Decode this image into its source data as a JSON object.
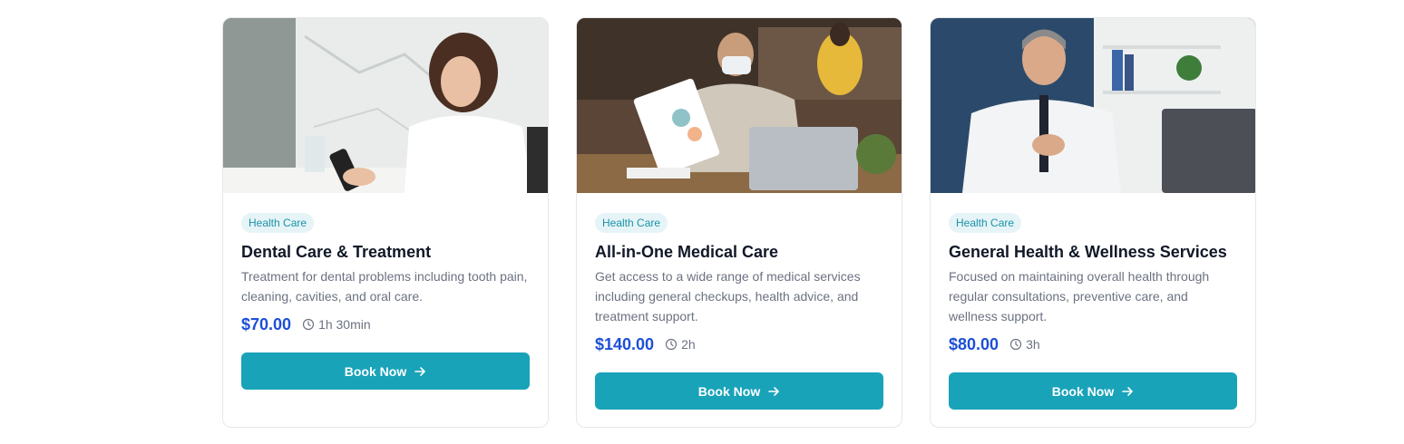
{
  "cards": [
    {
      "tag": "Health Care",
      "title": "Dental Care & Treatment",
      "description": "Treatment for dental problems including tooth pain, cleaning, cavities, and oral care.",
      "price": "$70.00",
      "duration": "1h 30min",
      "button_label": "Book Now"
    },
    {
      "tag": "Health Care",
      "title": "All-in-One Medical Care",
      "description": "Get access to a wide range of medical services including general checkups, health advice, and treatment support.",
      "price": "$140.00",
      "duration": "2h",
      "button_label": "Book Now"
    },
    {
      "tag": "Health Care",
      "title": "General Health & Wellness Services",
      "description": "Focused on maintaining overall health through regular consultations, preventive care, and wellness support.",
      "price": "$80.00",
      "duration": "3h",
      "button_label": "Book Now"
    }
  ],
  "colors": {
    "accent": "#19a3b9",
    "price": "#1d4fd8",
    "tag_bg": "#e6f4f7",
    "tag_text": "#1a93a8"
  },
  "icons": {
    "duration": "clock-icon",
    "button": "arrow-right-icon"
  }
}
